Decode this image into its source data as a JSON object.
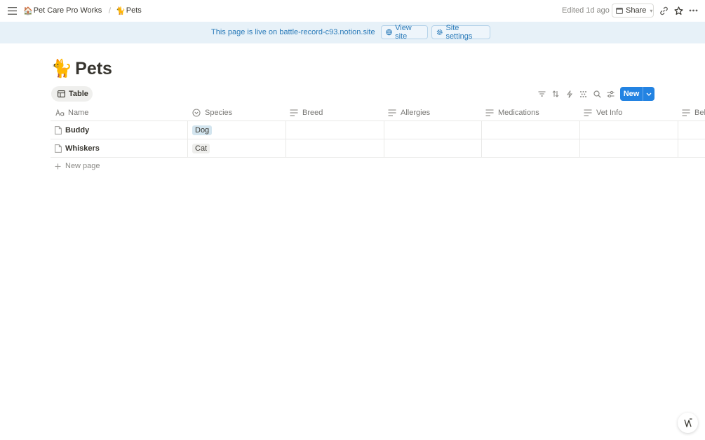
{
  "topbar": {
    "breadcrumbs": [
      {
        "emoji": "🏠",
        "label": "Pet Care Pro Workspace"
      },
      {
        "emoji": "🐈",
        "label": "Pets"
      }
    ],
    "separator": "/",
    "edited": "Edited 1d ago",
    "share_label": "Share"
  },
  "banner": {
    "text": "This page is live on battle-record-c93.notion.site",
    "view_site_label": "View site",
    "site_settings_label": "Site settings"
  },
  "page": {
    "emoji": "🐈",
    "title": "Pets"
  },
  "view": {
    "tab_label": "Table",
    "new_label": "New"
  },
  "table": {
    "columns": [
      "Name",
      "Species",
      "Breed",
      "Allergies",
      "Medications",
      "Vet Info",
      "Beh"
    ],
    "rows": [
      {
        "name": "Buddy",
        "species": "Dog",
        "species_color": "#d3e5ef"
      },
      {
        "name": "Whiskers",
        "species": "Cat",
        "species_color": "#eeeeec"
      }
    ],
    "new_page_label": "New page"
  },
  "colors": {
    "accent": "#2383e2",
    "banner_bg": "#e7f1f8",
    "banner_text": "#2b7bb9"
  }
}
